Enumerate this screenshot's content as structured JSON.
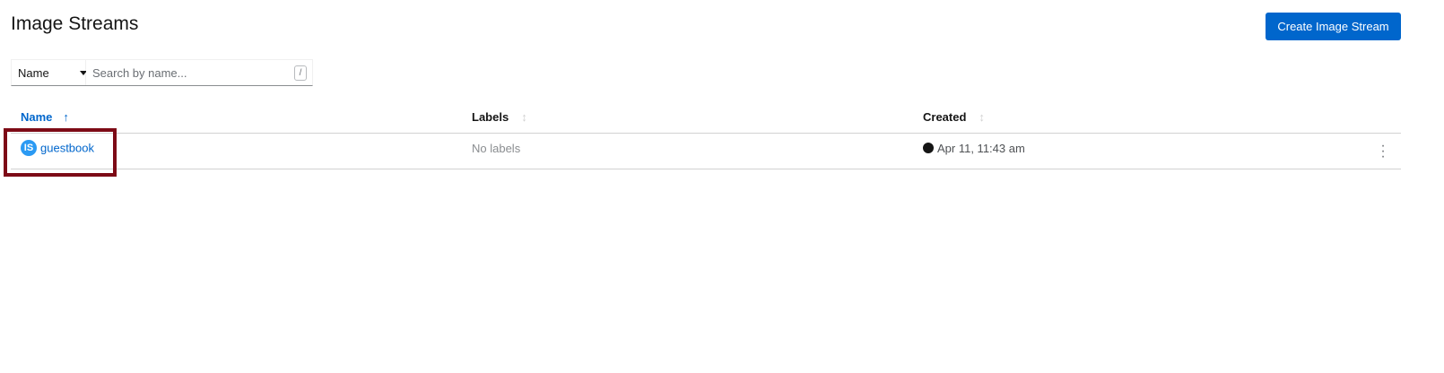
{
  "page": {
    "title": "Image Streams",
    "create_label": "Create Image Stream"
  },
  "filter": {
    "type": "Name",
    "placeholder": "Search by name...",
    "shortcut": "/"
  },
  "table": {
    "columns": [
      {
        "label": "Name",
        "sort": "ascending"
      },
      {
        "label": "Labels"
      },
      {
        "label": "Created"
      }
    ],
    "rows": [
      {
        "badge": "IS",
        "name": "guestbook",
        "labels": "No labels",
        "created": "Apr 11, 11:43 am"
      }
    ]
  },
  "colors": {
    "accent": "#0066cc",
    "badge": "#2b9af3",
    "highlight": "#7d0a16"
  }
}
